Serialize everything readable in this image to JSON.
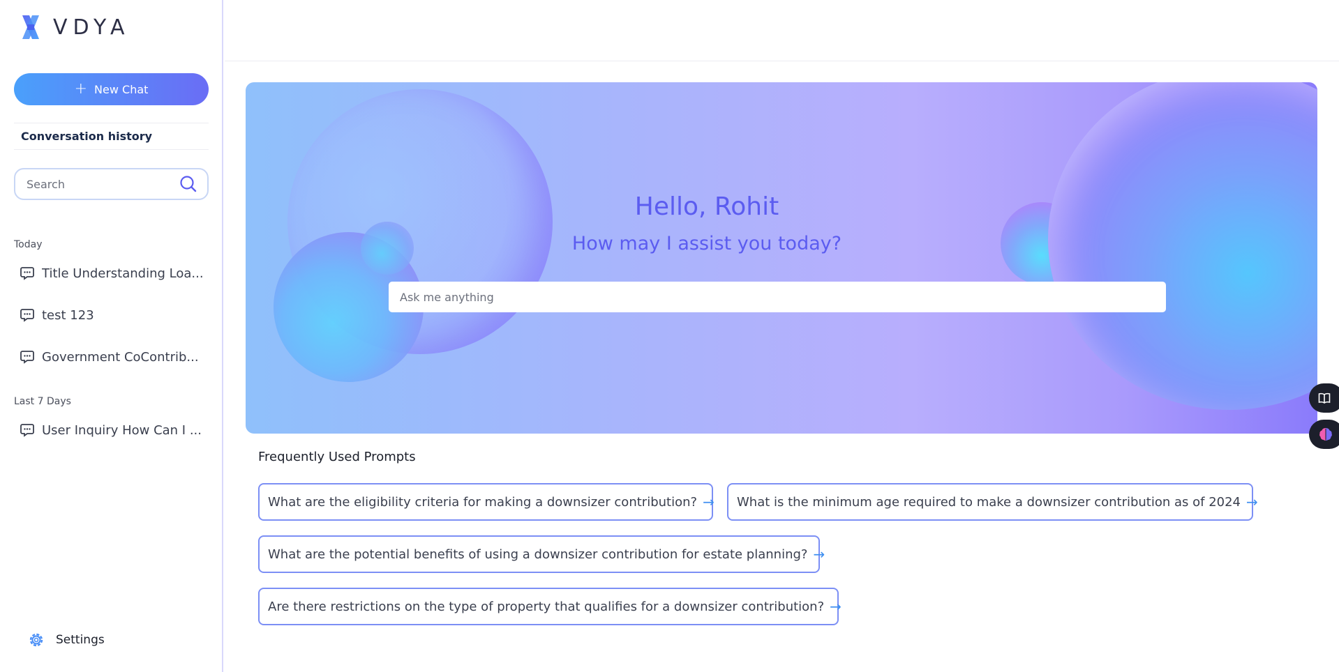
{
  "app": {
    "brand": "VDYA",
    "logo_icon": "vdya-x-logo",
    "colors": {
      "accent": "#5b5cf0",
      "button_gradient_start": "#4aa0fb",
      "button_gradient_end": "#6a6df5",
      "border": "#7c8ff5"
    }
  },
  "sidebar": {
    "new_chat_label": "New Chat",
    "conversation_history_label": "Conversation history",
    "search": {
      "placeholder": "Search",
      "value": ""
    },
    "groups": [
      {
        "label": "Today",
        "items": [
          {
            "label": "Title Understanding Loa...",
            "icon": "chat-bubble-icon"
          },
          {
            "label": "test 123",
            "icon": "chat-bubble-icon"
          },
          {
            "label": "Government CoContrib...",
            "icon": "chat-bubble-icon"
          }
        ]
      },
      {
        "label": "Last 7 Days",
        "items": [
          {
            "label": "User Inquiry How Can I ...",
            "icon": "chat-bubble-icon"
          }
        ]
      }
    ],
    "settings_label": "Settings"
  },
  "main": {
    "greeting": "Hello, Rohit",
    "subgreeting": "How may I assist you today?",
    "ask": {
      "placeholder": "Ask me anything",
      "value": ""
    },
    "frequent_title": "Frequently Used Prompts",
    "prompts": [
      "What are the eligibility criteria for making a downsizer contribution?",
      "What is the minimum age required to make a downsizer contribution as of 2024",
      "What are the potential benefits of using a downsizer contribution for estate planning?",
      "Are there restrictions on the type of property that qualifies for a downsizer contribution?"
    ],
    "side_buttons": [
      {
        "icon": "book-open-icon"
      },
      {
        "icon": "brain-icon"
      }
    ]
  }
}
